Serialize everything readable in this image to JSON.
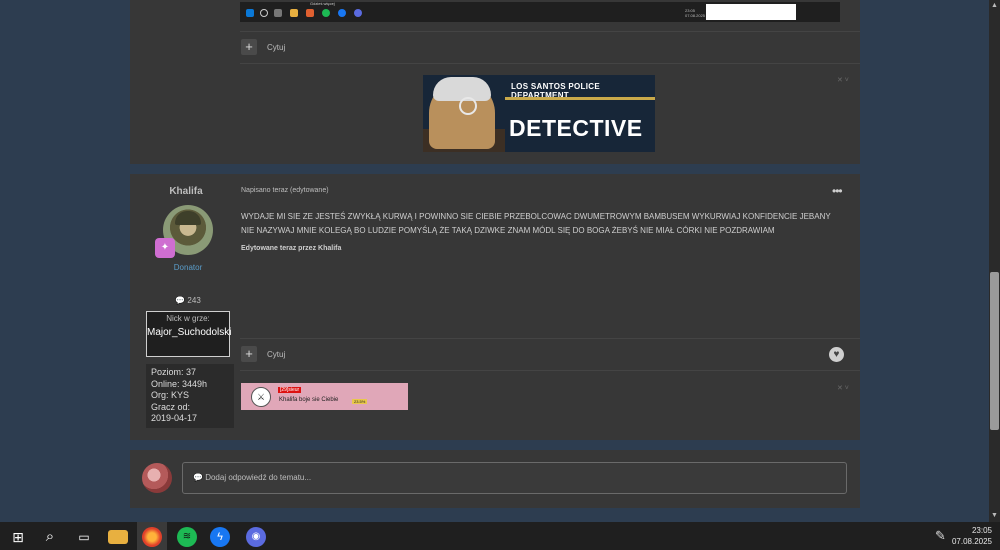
{
  "top_post": {
    "screenshot": {
      "tooltip": "Gdzieś więcej",
      "clock_time": "23:05",
      "clock_date": "07.08.2025"
    },
    "quote_label": "Cytuj",
    "signature": {
      "dept": "LOS SANTOS POLICE DEPARTMENT",
      "title": "DETECTIVE"
    }
  },
  "post": {
    "author": {
      "name": "Khalifa",
      "rank": "Donator",
      "post_count": "243",
      "nick_label": "Nick w grze:",
      "nick_value": "Major_Suchodolski",
      "stats": [
        "Poziom: 37",
        "Online: 3449h",
        "Org: KYS",
        "Gracz od:",
        "2019-04-17"
      ]
    },
    "meta": "Napisano teraz (edytowane)",
    "body": "WYDAJE MI SIE ZE JESTEŚ ZWYKŁĄ KURWĄ I POWINNO SIE CIEBIE PRZEBOLCOWAC DWUMETROWYM BAMBUSEM WYKURWIAJ KONFIDENCIE JEBANY NIE NAZYWAJ MNIE KOLEGĄ BO LUDZIE POMYŚLĄ ŻE TAKĄ DZIWKE ZNAM MÓDL SIĘ DO BOGA ŻEBYŚ NIE MIAŁ CÓRKI NIE POZDRAWIAM",
    "edit_note": "Edytowane teraz przez Khalifa",
    "quote_label": "Cytuj",
    "signature": {
      "tag": "[29]sieur",
      "text": "Khalifa boje sie Ciebie",
      "pct": "23.5%"
    }
  },
  "reply": {
    "placeholder": "Dodaj odpowiedź do tematu..."
  },
  "taskbar": {
    "time": "23:05",
    "date": "07.08.2025"
  },
  "colors": {
    "page_bg": "#2d3d50",
    "card_bg": "#373737",
    "rank_blue": "#5a9cc9",
    "badge_pink": "#cf6ed1"
  }
}
